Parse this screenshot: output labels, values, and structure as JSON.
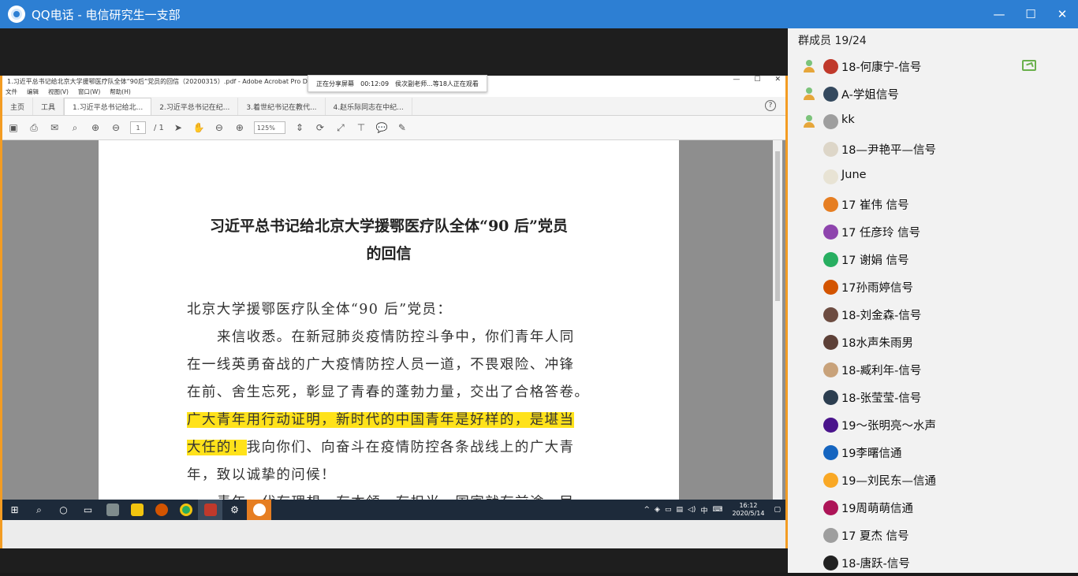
{
  "window": {
    "title": "QQ电话 - 电信研究生一支部",
    "controls": {
      "minimize": "—",
      "maximize": "☐",
      "close": "✕"
    }
  },
  "acrobat": {
    "title": "1.习近平总书记给北京大学援鄂医疗队全体“90后”党员的回信（20200315）.pdf - Adobe Acrobat Pro D",
    "share_banner": {
      "status": "正在分享屏幕",
      "time": "00:12:09",
      "viewers": "侯次副老师...等18人正在观看"
    },
    "menu": [
      "文件",
      "编辑",
      "视图(V)",
      "窗口(W)",
      "帮助(H)"
    ],
    "tabs": [
      {
        "label": "主页",
        "active": false
      },
      {
        "label": "工具",
        "active": false
      },
      {
        "label": "1.习近平总书记给北...",
        "active": true
      },
      {
        "label": "2.习近平总书记在纪...",
        "active": false
      },
      {
        "label": "3.着世纪书记在教代...",
        "active": false
      },
      {
        "label": "4.赵乐际同志在中纪...",
        "active": false
      }
    ],
    "page_current": "1",
    "page_total": "/ 1",
    "zoom": "125%",
    "document": {
      "title_line1": "习近平总书记给北京大学援鄂医疗队全体“90 后”党员",
      "title_line2": "的回信",
      "salutation": "北京大学援鄂医疗队全体“90 后”党员：",
      "line1": "来信收悉。在新冠肺炎疫情防控斗争中，你们青年人同",
      "line2": "在一线英勇奋战的广大疫情防控人员一道，不畏艰险、冲锋",
      "line3": "在前、舍生忘死，彰显了青春的蓬勃力量，交出了合格答卷。",
      "line4_highlight": "广大青年用行动证明，新时代的中国青年是好样的，是堪当",
      "line5_highlight": "大任的！",
      "line5_rest": "我向你们、向奋斗在疫情防控各条战线上的广大青",
      "line6": "年，致以诚挚的问候！",
      "line7_partial": "青年一代有理想、有本领、有担当，国家就有前途，民"
    }
  },
  "taskbar": {
    "clock_time": "16:12",
    "clock_date": "2020/5/14",
    "ime": "中"
  },
  "members": {
    "header": "群成员 19/24",
    "list": [
      {
        "name": "18-何康宁-信号",
        "speaking": true,
        "sharing": true,
        "avatar_color": "#c0392b"
      },
      {
        "name": "A-学姐信号",
        "speaking": true,
        "sharing": false,
        "avatar_color": "#34495e"
      },
      {
        "name": "kk",
        "speaking": true,
        "sharing": false,
        "avatar_color": "#9e9e9e"
      },
      {
        "name": "18—尹艳平—信号",
        "speaking": false,
        "sharing": false,
        "avatar_color": "#ddd6c8"
      },
      {
        "name": "June",
        "speaking": false,
        "sharing": false,
        "avatar_color": "#e8e3d4"
      },
      {
        "name": "17 崔伟 信号",
        "speaking": false,
        "sharing": false,
        "avatar_color": "#e67e22"
      },
      {
        "name": "17 任彦玲 信号",
        "speaking": false,
        "sharing": false,
        "avatar_color": "#8e44ad"
      },
      {
        "name": "17 谢娟 信号",
        "speaking": false,
        "sharing": false,
        "avatar_color": "#27ae60"
      },
      {
        "name": "17孙雨婷信号",
        "speaking": false,
        "sharing": false,
        "avatar_color": "#d35400"
      },
      {
        "name": "18-刘金森-信号",
        "speaking": false,
        "sharing": false,
        "avatar_color": "#6d4c41"
      },
      {
        "name": "18水声朱雨男",
        "speaking": false,
        "sharing": false,
        "avatar_color": "#5d4037"
      },
      {
        "name": "18-臧利年-信号",
        "speaking": false,
        "sharing": false,
        "avatar_color": "#c8a27a"
      },
      {
        "name": "18-张莹莹-信号",
        "speaking": false,
        "sharing": false,
        "avatar_color": "#2c3e50"
      },
      {
        "name": "19～张明亮～水声",
        "speaking": false,
        "sharing": false,
        "avatar_color": "#4a148c"
      },
      {
        "name": "19李曙信通",
        "speaking": false,
        "sharing": false,
        "avatar_color": "#1565c0"
      },
      {
        "name": "19—刘民东—信通",
        "speaking": false,
        "sharing": false,
        "avatar_color": "#f9a825"
      },
      {
        "name": "19周萌萌信通",
        "speaking": false,
        "sharing": false,
        "avatar_color": "#ad1457"
      },
      {
        "name": "17 夏杰 信号",
        "speaking": false,
        "sharing": false,
        "avatar_color": "#9e9e9e"
      },
      {
        "name": "18-唐跃-信号",
        "speaking": false,
        "sharing": false,
        "avatar_color": "#212121"
      }
    ]
  }
}
